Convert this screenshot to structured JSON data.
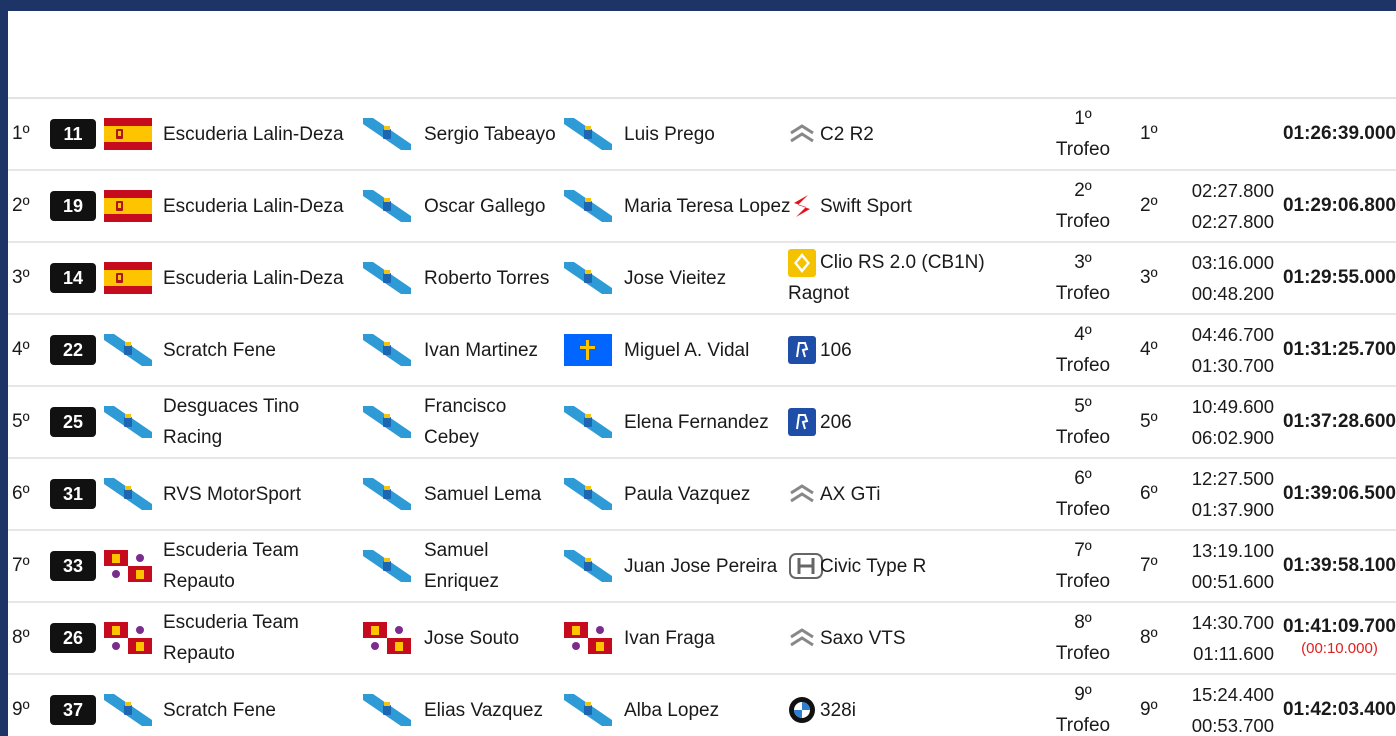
{
  "colors": {
    "frame": "#1c3566",
    "penalty": "#e02020",
    "number_bg": "#111111"
  },
  "rows": [
    {
      "pos": "1º",
      "number": "11",
      "team_flag": "spain-flag",
      "team": "Escuderia Lalin-Deza",
      "pilot_flag": "galicia-flag",
      "pilot": "Sergio Tabeayo",
      "copilot_flag": "galicia-flag",
      "copilot": "Luis Prego",
      "car_logo": "citroen-logo-icon",
      "car": "C2 R2",
      "car2": "",
      "trofeo_pos": "1º",
      "trofeo": "Trofeo",
      "class_pos": "1º",
      "gap_prev": "",
      "gap_first": "",
      "total": "01:26:39.000",
      "penalty": ""
    },
    {
      "pos": "2º",
      "number": "19",
      "team_flag": "spain-flag",
      "team": "Escuderia Lalin-Deza",
      "pilot_flag": "galicia-flag",
      "pilot": "Oscar Gallego",
      "copilot_flag": "galicia-flag",
      "copilot": "Maria Teresa Lopez",
      "car_logo": "suzuki-logo-icon",
      "car": "Swift Sport",
      "car2": "",
      "trofeo_pos": "2º",
      "trofeo": "Trofeo",
      "class_pos": "2º",
      "gap_prev": "02:27.800",
      "gap_first": "02:27.800",
      "total": "01:29:06.800",
      "penalty": ""
    },
    {
      "pos": "3º",
      "number": "14",
      "team_flag": "spain-flag",
      "team": "Escuderia Lalin-Deza",
      "pilot_flag": "galicia-flag",
      "pilot": "Roberto Torres",
      "copilot_flag": "galicia-flag",
      "copilot": "Jose Vieitez",
      "car_logo": "renault-logo-icon",
      "car": "Clio RS 2.0 (CB1N)",
      "car2": "Ragnot",
      "trofeo_pos": "3º",
      "trofeo": "Trofeo",
      "class_pos": "3º",
      "gap_prev": "03:16.000",
      "gap_first": "00:48.200",
      "total": "01:29:55.000",
      "penalty": ""
    },
    {
      "pos": "4º",
      "number": "22",
      "team_flag": "galicia-flag",
      "team": "Scratch Fene",
      "pilot_flag": "galicia-flag",
      "pilot": "Ivan Martinez",
      "copilot_flag": "asturias-flag",
      "copilot": "Miguel A. Vidal",
      "car_logo": "peugeot-logo-icon",
      "car": "106",
      "car2": "",
      "trofeo_pos": "4º",
      "trofeo": "Trofeo",
      "class_pos": "4º",
      "gap_prev": "04:46.700",
      "gap_first": "01:30.700",
      "total": "01:31:25.700",
      "penalty": ""
    },
    {
      "pos": "5º",
      "number": "25",
      "team_flag": "galicia-flag",
      "team": "Desguaces Tino Racing",
      "pilot_flag": "galicia-flag",
      "pilot": "Francisco Cebey",
      "copilot_flag": "galicia-flag",
      "copilot": "Elena Fernandez",
      "car_logo": "peugeot-logo-icon",
      "car": "206",
      "car2": "",
      "trofeo_pos": "5º",
      "trofeo": "Trofeo",
      "class_pos": "5º",
      "gap_prev": "10:49.600",
      "gap_first": "06:02.900",
      "total": "01:37:28.600",
      "penalty": ""
    },
    {
      "pos": "6º",
      "number": "31",
      "team_flag": "galicia-flag",
      "team": "RVS MotorSport",
      "pilot_flag": "galicia-flag",
      "pilot": "Samuel Lema",
      "copilot_flag": "galicia-flag",
      "copilot": "Paula Vazquez",
      "car_logo": "citroen-logo-icon",
      "car": "AX GTi",
      "car2": "",
      "trofeo_pos": "6º",
      "trofeo": "Trofeo",
      "class_pos": "6º",
      "gap_prev": "12:27.500",
      "gap_first": "01:37.900",
      "total": "01:39:06.500",
      "penalty": ""
    },
    {
      "pos": "7º",
      "number": "33",
      "team_flag": "castilla-leon-flag",
      "team": "Escuderia Team Repauto",
      "pilot_flag": "galicia-flag",
      "pilot": "Samuel Enriquez",
      "copilot_flag": "galicia-flag",
      "copilot": "Juan Jose Pereira",
      "car_logo": "honda-logo-icon",
      "car": "Civic Type R",
      "car2": "",
      "trofeo_pos": "7º",
      "trofeo": "Trofeo",
      "class_pos": "7º",
      "gap_prev": "13:19.100",
      "gap_first": "00:51.600",
      "total": "01:39:58.100",
      "penalty": ""
    },
    {
      "pos": "8º",
      "number": "26",
      "team_flag": "castilla-leon-flag",
      "team": "Escuderia Team Repauto",
      "pilot_flag": "castilla-leon-flag",
      "pilot": "Jose Souto",
      "copilot_flag": "castilla-leon-flag",
      "copilot": "Ivan Fraga",
      "car_logo": "citroen-logo-icon",
      "car": "Saxo VTS",
      "car2": "",
      "trofeo_pos": "8º",
      "trofeo": "Trofeo",
      "class_pos": "8º",
      "gap_prev": "14:30.700",
      "gap_first": "01:11.600",
      "total": "01:41:09.700",
      "penalty": "(00:10.000)"
    },
    {
      "pos": "9º",
      "number": "37",
      "team_flag": "galicia-flag",
      "team": "Scratch Fene",
      "pilot_flag": "galicia-flag",
      "pilot": "Elias Vazquez",
      "copilot_flag": "galicia-flag",
      "copilot": "Alba Lopez",
      "car_logo": "bmw-logo-icon",
      "car": "328i",
      "car2": "",
      "trofeo_pos": "9º",
      "trofeo": "Trofeo",
      "class_pos": "9º",
      "gap_prev": "15:24.400",
      "gap_first": "00:53.700",
      "total": "01:42:03.400",
      "penalty": ""
    }
  ]
}
